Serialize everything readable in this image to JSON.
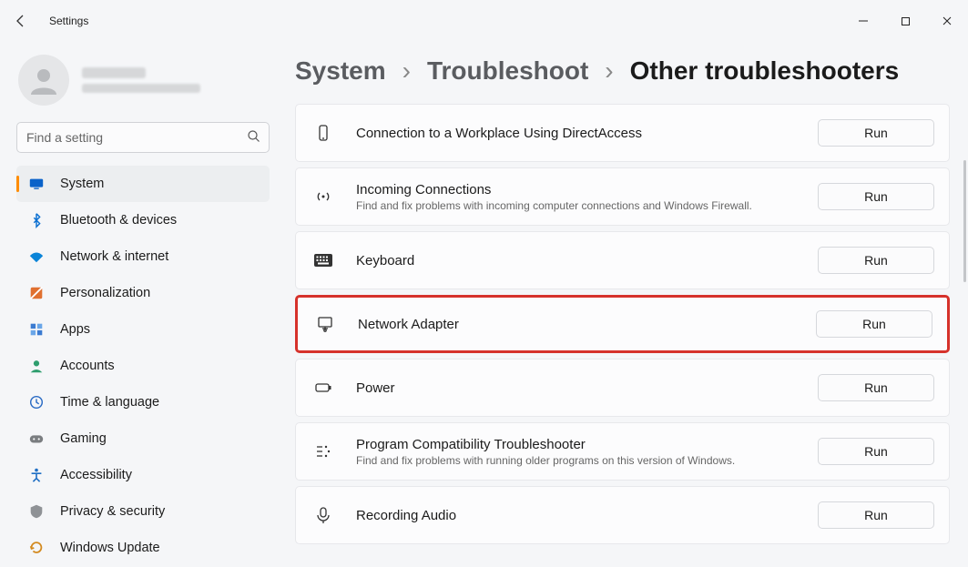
{
  "window": {
    "title": "Settings"
  },
  "search": {
    "placeholder": "Find a setting"
  },
  "nav": {
    "items": [
      {
        "label": "System",
        "key": "system",
        "selected": true
      },
      {
        "label": "Bluetooth & devices",
        "key": "bluetooth"
      },
      {
        "label": "Network & internet",
        "key": "network"
      },
      {
        "label": "Personalization",
        "key": "personalization"
      },
      {
        "label": "Apps",
        "key": "apps"
      },
      {
        "label": "Accounts",
        "key": "accounts"
      },
      {
        "label": "Time & language",
        "key": "time"
      },
      {
        "label": "Gaming",
        "key": "gaming"
      },
      {
        "label": "Accessibility",
        "key": "accessibility"
      },
      {
        "label": "Privacy & security",
        "key": "privacy"
      },
      {
        "label": "Windows Update",
        "key": "update"
      }
    ]
  },
  "breadcrumb": {
    "level1": "System",
    "level2": "Troubleshoot",
    "current": "Other troubleshooters"
  },
  "run_label": "Run",
  "troubleshooters": [
    {
      "title": "Connection to a Workplace Using DirectAccess",
      "desc": "",
      "icon": "phone"
    },
    {
      "title": "Incoming Connections",
      "desc": "Find and fix problems with incoming computer connections and Windows Firewall.",
      "icon": "signal"
    },
    {
      "title": "Keyboard",
      "desc": "",
      "icon": "keyboard"
    },
    {
      "title": "Network Adapter",
      "desc": "",
      "icon": "adapter",
      "highlight": true
    },
    {
      "title": "Power",
      "desc": "",
      "icon": "battery"
    },
    {
      "title": "Program Compatibility Troubleshooter",
      "desc": "Find and fix problems with running older programs on this version of Windows.",
      "icon": "compat"
    },
    {
      "title": "Recording Audio",
      "desc": "",
      "icon": "mic"
    }
  ]
}
